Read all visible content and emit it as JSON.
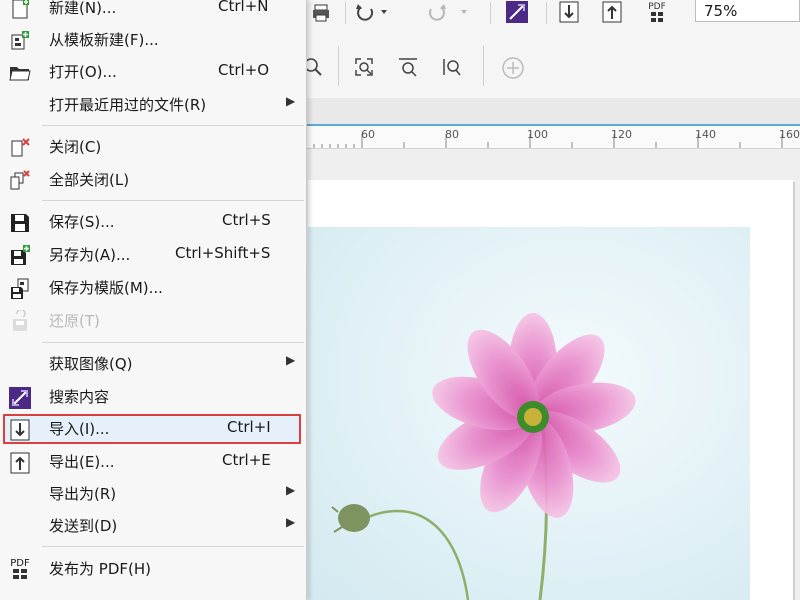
{
  "menu": {
    "items": [
      {
        "label": "新建(N)...",
        "shortcut": "Ctrl+N",
        "icon": "new-file-icon"
      },
      {
        "label": "从模板新建(F)...",
        "shortcut": "",
        "icon": "new-from-template-icon"
      },
      {
        "label": "打开(O)...",
        "shortcut": "Ctrl+O",
        "icon": "folder-open-icon"
      },
      {
        "label": "打开最近用过的文件(R)",
        "shortcut": "",
        "icon": "",
        "submenu": true
      },
      {
        "label": "关闭(C)",
        "shortcut": "",
        "icon": "close-doc-icon"
      },
      {
        "label": "全部关闭(L)",
        "shortcut": "",
        "icon": "close-all-icon"
      },
      {
        "label": "保存(S)...",
        "shortcut": "Ctrl+S",
        "icon": "save-icon"
      },
      {
        "label": "另存为(A)...",
        "shortcut": "Ctrl+Shift+S",
        "icon": "save-as-icon"
      },
      {
        "label": "保存为模版(M)...",
        "shortcut": "",
        "icon": "save-as-template-icon"
      },
      {
        "label": "还原(T)",
        "shortcut": "",
        "icon": "revert-icon",
        "disabled": true
      },
      {
        "label": "获取图像(Q)",
        "shortcut": "",
        "icon": "",
        "submenu": true
      },
      {
        "label": "搜索内容",
        "shortcut": "",
        "icon": "search-content-icon"
      },
      {
        "label": "导入(I)...",
        "shortcut": "Ctrl+I",
        "icon": "import-icon",
        "highlighted": true
      },
      {
        "label": "导出(E)...",
        "shortcut": "Ctrl+E",
        "icon": "export-icon"
      },
      {
        "label": "导出为(R)",
        "shortcut": "",
        "icon": "",
        "submenu": true
      },
      {
        "label": "发送到(D)",
        "shortcut": "",
        "icon": "",
        "submenu": true
      },
      {
        "label": "发布为 PDF(H)",
        "shortcut": "",
        "icon": "pdf-icon"
      }
    ],
    "highlight_color": "#d9413f"
  },
  "toolbar": {
    "zoom": "75%",
    "pdf_label": "PDF"
  },
  "ruler": {
    "ticks": [
      "60",
      "80",
      "100",
      "120",
      "140",
      "160"
    ]
  },
  "pdf_icon_text": "PDF"
}
